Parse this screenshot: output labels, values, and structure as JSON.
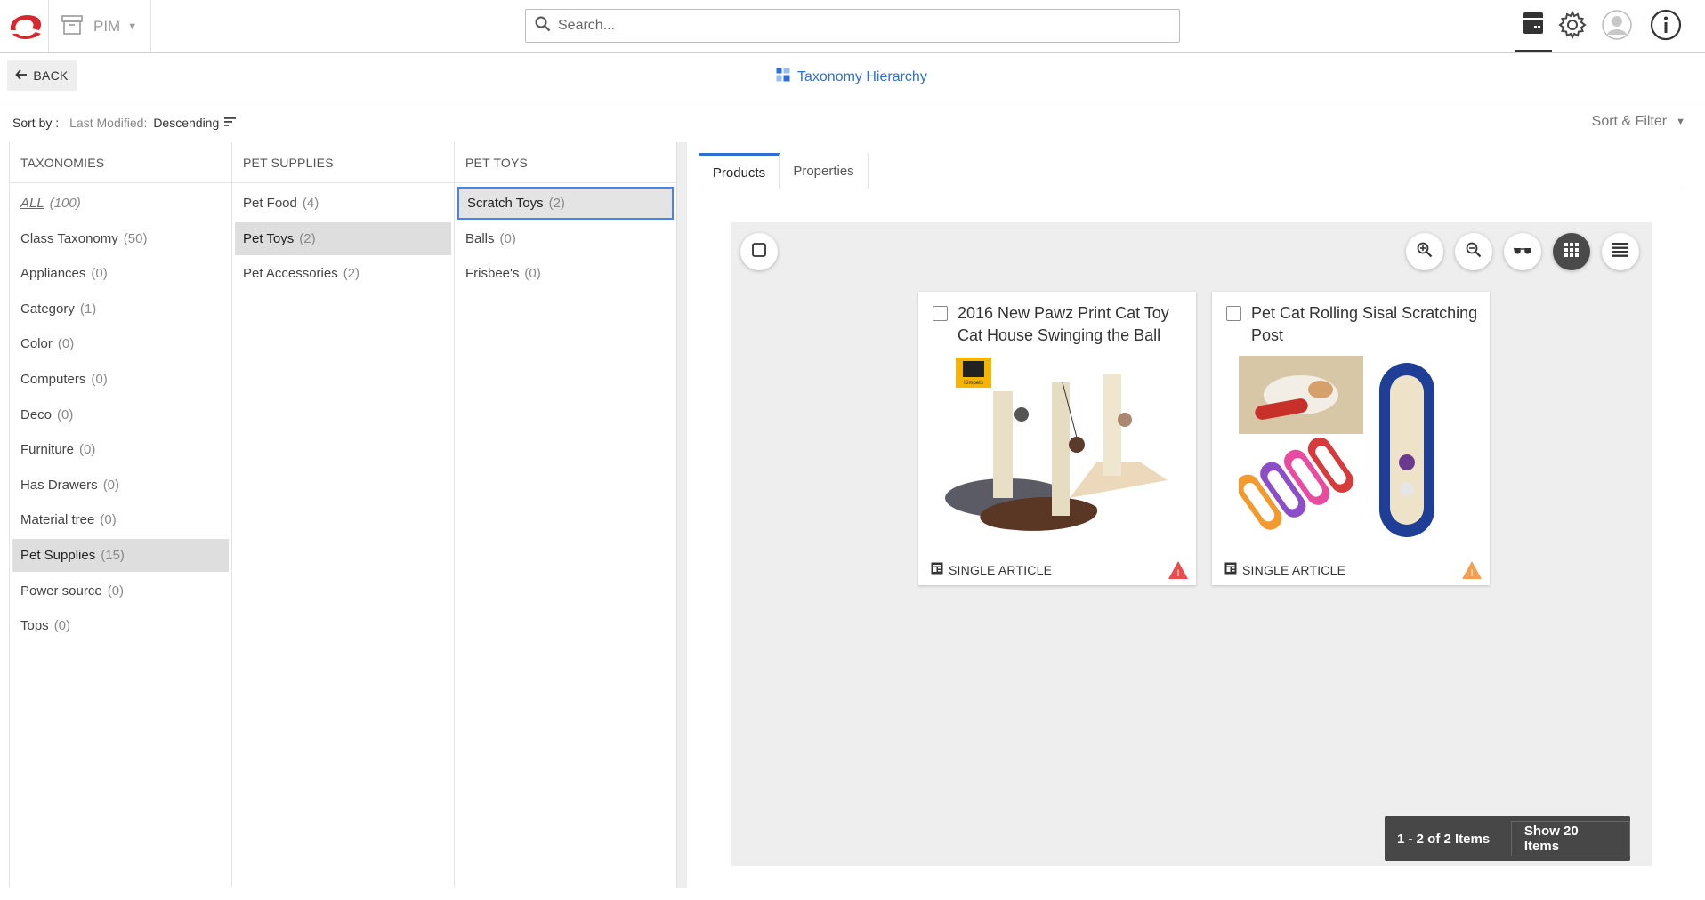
{
  "topbar": {
    "app_label": "PIM",
    "search_placeholder": "Search..."
  },
  "header": {
    "back_label": "BACK",
    "title": "Taxonomy Hierarchy"
  },
  "sort": {
    "sort_by": "Sort by :",
    "field": "Last Modified:",
    "direction": "Descending",
    "sort_filter_label": "Sort & Filter"
  },
  "columns": {
    "taxonomies": {
      "header": "TAXONOMIES",
      "items": [
        {
          "name": "ALL",
          "count": "(100)"
        },
        {
          "name": "Class Taxonomy",
          "count": "(50)"
        },
        {
          "name": "Appliances",
          "count": "(0)"
        },
        {
          "name": "Category",
          "count": "(1)"
        },
        {
          "name": "Color",
          "count": "(0)"
        },
        {
          "name": "Computers",
          "count": "(0)"
        },
        {
          "name": "Deco",
          "count": "(0)"
        },
        {
          "name": "Furniture",
          "count": "(0)"
        },
        {
          "name": "Has Drawers",
          "count": "(0)"
        },
        {
          "name": "Material tree",
          "count": "(0)"
        },
        {
          "name": "Pet Supplies",
          "count": "(15)"
        },
        {
          "name": "Power source",
          "count": "(0)"
        },
        {
          "name": "Tops",
          "count": "(0)"
        }
      ]
    },
    "pet_supplies": {
      "header": "PET SUPPLIES",
      "items": [
        {
          "name": "Pet Food",
          "count": "(4)"
        },
        {
          "name": "Pet Toys",
          "count": "(2)"
        },
        {
          "name": "Pet Accessories",
          "count": "(2)"
        }
      ]
    },
    "pet_toys": {
      "header": "PET TOYS",
      "items": [
        {
          "name": "Scratch Toys",
          "count": "(2)"
        },
        {
          "name": "Balls",
          "count": "(0)"
        },
        {
          "name": "Frisbee's",
          "count": "(0)"
        }
      ]
    }
  },
  "tabs": [
    {
      "label": "Products"
    },
    {
      "label": "Properties"
    }
  ],
  "products": [
    {
      "title": "2016 New Pawz Print Cat Toy Cat House Swinging the Ball",
      "type": "SINGLE ARTICLE",
      "badge": "!",
      "badge_color": "#e84c4c",
      "image_label": "Kimpets"
    },
    {
      "title": "Pet Cat Rolling Sisal Scratching Post",
      "type": "SINGLE ARTICLE",
      "badge": "!",
      "badge_color": "#f0a050"
    }
  ],
  "pager": {
    "range": "1 - 2 of 2 Items",
    "show": "Show 20 Items"
  },
  "colors": {
    "accent": "#2f6fd4",
    "logo": "#d7262c"
  }
}
